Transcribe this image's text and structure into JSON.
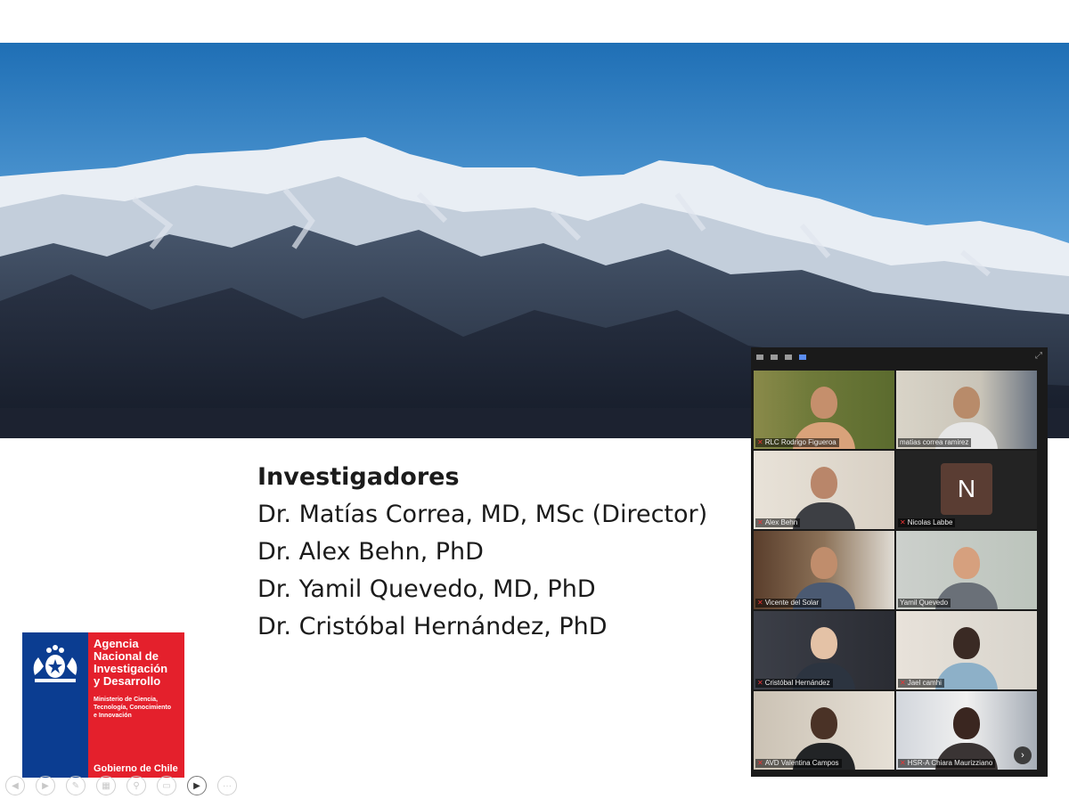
{
  "slide": {
    "heading": "Investigadores",
    "researchers": [
      "Dr. Matías Correa, MD, MSc (Director)",
      "Dr. Alex Behn, PhD",
      "Dr. Yamil Quevedo, MD, PhD",
      "Dr. Cristóbal Hernández, PhD"
    ]
  },
  "logo": {
    "agency_line1": "Agencia",
    "agency_line2": "Nacional de",
    "agency_line3": "Investigación",
    "agency_line4": "y Desarrollo",
    "ministry_line1": "Ministerio de Ciencia,",
    "ministry_line2": "Tecnología, Conocimiento",
    "ministry_line3": "e Innovación",
    "government": "Gobierno de Chile",
    "colors": {
      "blue": "#0b3d91",
      "red": "#e4202c"
    }
  },
  "video_call": {
    "view_buttons": [
      "speaker-view-icon",
      "film-view-icon",
      "side-view-icon",
      "gallery-view-icon"
    ],
    "participants": [
      {
        "name": "RLC Rodrigo Figueroa",
        "muted": true,
        "speaking": false
      },
      {
        "name": "matias correa ramirez",
        "muted": false,
        "speaking": false
      },
      {
        "name": "Alex Behn",
        "muted": true,
        "speaking": false
      },
      {
        "name": "Nicolas Labbe",
        "muted": true,
        "speaking": false,
        "initial": "N"
      },
      {
        "name": "Vicente del Solar",
        "muted": true,
        "speaking": false
      },
      {
        "name": "Yamil Quevedo",
        "muted": false,
        "speaking": true
      },
      {
        "name": "Cristóbal Hernández",
        "muted": true,
        "speaking": false
      },
      {
        "name": "Jael camhi",
        "muted": true,
        "speaking": false
      },
      {
        "name": "AVD Valentina Campos",
        "muted": true,
        "speaking": false
      },
      {
        "name": "HSR-A Chiara Maurizziano",
        "muted": true,
        "speaking": false
      }
    ],
    "accent_color": "#2fd07a"
  },
  "toolbar": {
    "buttons": [
      "previous-icon",
      "next-icon",
      "pen-icon",
      "slides-icon",
      "zoom-icon",
      "subtitles-icon",
      "camera-icon",
      "more-icon"
    ]
  }
}
